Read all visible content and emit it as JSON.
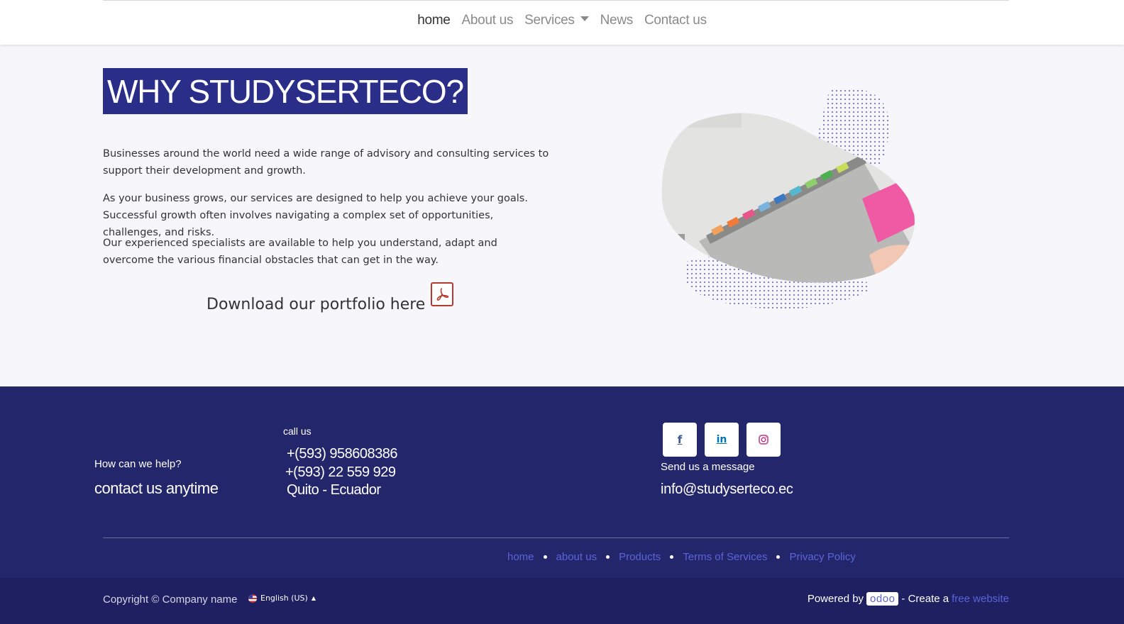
{
  "nav": {
    "items": [
      {
        "label": "home",
        "active": true
      },
      {
        "label": "About us"
      },
      {
        "label": "Services",
        "dropdown": true
      },
      {
        "label": "News"
      },
      {
        "label": "Contact us"
      }
    ]
  },
  "hero": {
    "title": "WHY STUDYSERTECO?",
    "paragraphs": [
      "Businesses around the world need a wide range of advisory and consulting services to support their development and growth.",
      "As your business grows, our services are designed to help you achieve your goals. Successful growth often involves navigating a complex set of opportunities, challenges, and risks.",
      "Our experienced specialists are available to help you understand, adapt and overcome the various financial obstacles that can get in the way."
    ],
    "download_label": "Download our portfolio here",
    "pdf_icon": "pdf-icon",
    "image": "office-calendar-photo"
  },
  "footer": {
    "help_label": "How can we help?",
    "contact_label": "contact us anytime",
    "call_label": "call us",
    "phone1": "+(593) 958608386",
    "phone2": "+(593) 22 559 929",
    "city": "Quito - Ecuador",
    "social": [
      {
        "icon": "facebook-icon",
        "glyph": "f",
        "color": "#3b5998"
      },
      {
        "icon": "linkedin-icon",
        "glyph": "in",
        "color": "#0077b5"
      },
      {
        "icon": "instagram-icon",
        "glyph": "◎",
        "color": "#c13584"
      }
    ],
    "message_label": "Send us a message",
    "email": "info@studyserteco.ec",
    "links": [
      "home",
      "about us",
      "Products",
      "Terms of Services",
      "Privacy Policy"
    ]
  },
  "bottombar": {
    "copyright": "Copyright © Company name",
    "language": "English (US)",
    "powered_by": "Powered by",
    "odoo": "odoo",
    "create": "- Create a",
    "free_website": "free website"
  },
  "colors": {
    "brand": "#2a2e88",
    "footer": "#24266b",
    "link": "#5b64d8"
  }
}
